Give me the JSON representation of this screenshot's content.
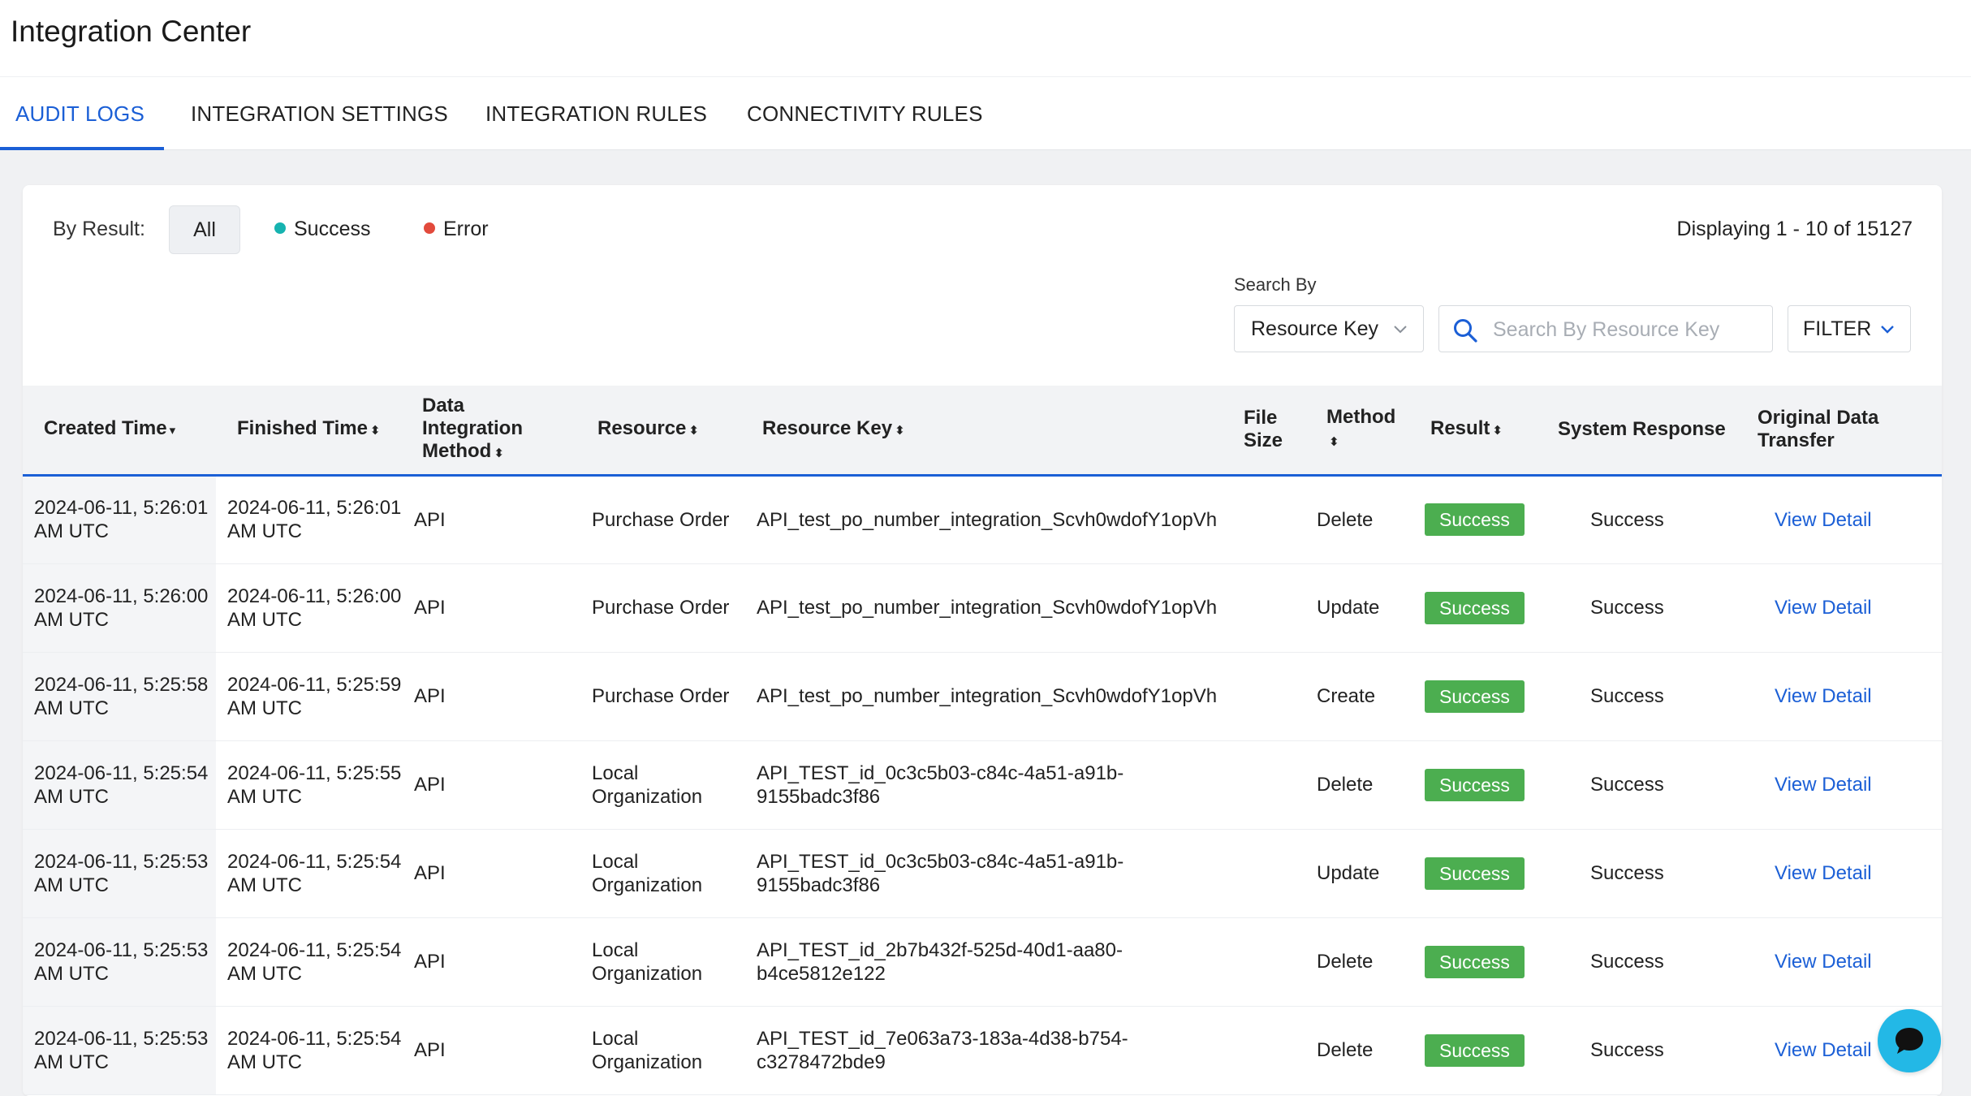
{
  "app": {
    "title": "Integration Center"
  },
  "tabs": [
    {
      "label": "AUDIT LOGS",
      "active": true
    },
    {
      "label": "INTEGRATION SETTINGS",
      "active": false
    },
    {
      "label": "INTEGRATION RULES",
      "active": false
    },
    {
      "label": "CONNECTIVITY RULES",
      "active": false
    }
  ],
  "filter": {
    "by_result_label": "By Result:",
    "options": [
      {
        "label": "All",
        "selected": true
      },
      {
        "label": "Success",
        "dot_color": "#16b3b0"
      },
      {
        "label": "Error",
        "dot_color": "#e24a3c"
      }
    ]
  },
  "pagination": {
    "display_text": "Displaying 1 - 10 of 15127"
  },
  "search": {
    "search_by_label": "Search By",
    "select_value": "Resource Key",
    "placeholder": "Search By Resource Key",
    "filter_button": "FILTER"
  },
  "table": {
    "columns": [
      {
        "label": "Created Time",
        "sort": "▾"
      },
      {
        "label": "Finished Time",
        "sort": "⬍"
      },
      {
        "label": "Data Integration Method",
        "sort": "⬍"
      },
      {
        "label": "Resource",
        "sort": "⬍"
      },
      {
        "label": "Resource Key",
        "sort": "⬍"
      },
      {
        "label": "File Size",
        "sort": ""
      },
      {
        "label": "Method",
        "sort": "⬍"
      },
      {
        "label": "Result",
        "sort": "⬍"
      },
      {
        "label": "System Response",
        "sort": ""
      },
      {
        "label": "Original Data Transfer",
        "sort": ""
      }
    ],
    "rows": [
      {
        "created": "2024-06-11, 5:26:01 AM UTC",
        "finished": "2024-06-11, 5:26:01 AM UTC",
        "integration_method": "API",
        "resource": "Purchase Order",
        "resource_key": "API_test_po_number_integration_Scvh0wdofY1opVh",
        "file_size": "",
        "method": "Delete",
        "result": "Success",
        "system_response": "Success",
        "original": "View Detail"
      },
      {
        "created": "2024-06-11, 5:26:00 AM UTC",
        "finished": "2024-06-11, 5:26:00 AM UTC",
        "integration_method": "API",
        "resource": "Purchase Order",
        "resource_key": "API_test_po_number_integration_Scvh0wdofY1opVh",
        "file_size": "",
        "method": "Update",
        "result": "Success",
        "system_response": "Success",
        "original": "View Detail"
      },
      {
        "created": "2024-06-11, 5:25:58 AM UTC",
        "finished": "2024-06-11, 5:25:59 AM UTC",
        "integration_method": "API",
        "resource": "Purchase Order",
        "resource_key": "API_test_po_number_integration_Scvh0wdofY1opVh",
        "file_size": "",
        "method": "Create",
        "result": "Success",
        "system_response": "Success",
        "original": "View Detail"
      },
      {
        "created": "2024-06-11, 5:25:54 AM UTC",
        "finished": "2024-06-11, 5:25:55 AM UTC",
        "integration_method": "API",
        "resource": "Local Organization",
        "resource_key": "API_TEST_id_0c3c5b03-c84c-4a51-a91b-9155badc3f86",
        "file_size": "",
        "method": "Delete",
        "result": "Success",
        "system_response": "Success",
        "original": "View Detail"
      },
      {
        "created": "2024-06-11, 5:25:53 AM UTC",
        "finished": "2024-06-11, 5:25:54 AM UTC",
        "integration_method": "API",
        "resource": "Local Organization",
        "resource_key": "API_TEST_id_0c3c5b03-c84c-4a51-a91b-9155badc3f86",
        "file_size": "",
        "method": "Update",
        "result": "Success",
        "system_response": "Success",
        "original": "View Detail"
      },
      {
        "created": "2024-06-11, 5:25:53 AM UTC",
        "finished": "2024-06-11, 5:25:54 AM UTC",
        "integration_method": "API",
        "resource": "Local Organization",
        "resource_key": "API_TEST_id_2b7b432f-525d-40d1-aa80-b4ce5812e122",
        "file_size": "",
        "method": "Delete",
        "result": "Success",
        "system_response": "Success",
        "original": "View Detail"
      },
      {
        "created": "2024-06-11, 5:25:53 AM UTC",
        "finished": "2024-06-11, 5:25:54 AM UTC",
        "integration_method": "API",
        "resource": "Local Organization",
        "resource_key": "API_TEST_id_7e063a73-183a-4d38-b754-c3278472bde9",
        "file_size": "",
        "method": "Delete",
        "result": "Success",
        "system_response": "Success",
        "original": "View Detail"
      }
    ]
  },
  "icons": {
    "search": "search-icon",
    "chevron": "chevron-down-icon",
    "chat": "chat-icon"
  },
  "colors": {
    "accent": "#1b5fd6",
    "success_badge": "#4cae50",
    "chat": "#23b8e6"
  }
}
